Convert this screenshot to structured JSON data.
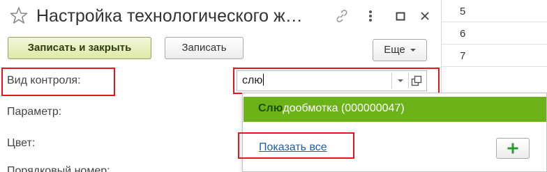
{
  "window": {
    "title": "Настройка технологического ж…",
    "icons": [
      "star-icon",
      "link-icon",
      "more-vertical-icon",
      "maximize-icon",
      "close-icon"
    ]
  },
  "toolbar": {
    "save_close_label": "Записать и закрыть",
    "save_label": "Записать",
    "more_label": "Еще"
  },
  "form": {
    "control_type_label": "Вид контроля:",
    "control_type_value": "слю",
    "parameter_label": "Параметр:",
    "color_label": "Цвет:",
    "order_label": "Порядковый номер:"
  },
  "dropdown": {
    "item_match": "Слю",
    "item_rest": "дообмотка (000000047)",
    "show_all_label": "Показать все"
  },
  "right_table": {
    "rows": [
      "5",
      "6",
      "7"
    ]
  },
  "colors": {
    "accent_green": "#6cb31a",
    "highlight_red": "#e4161b",
    "link_blue": "#1d5fae",
    "primary_button": "#dfe9a7"
  }
}
